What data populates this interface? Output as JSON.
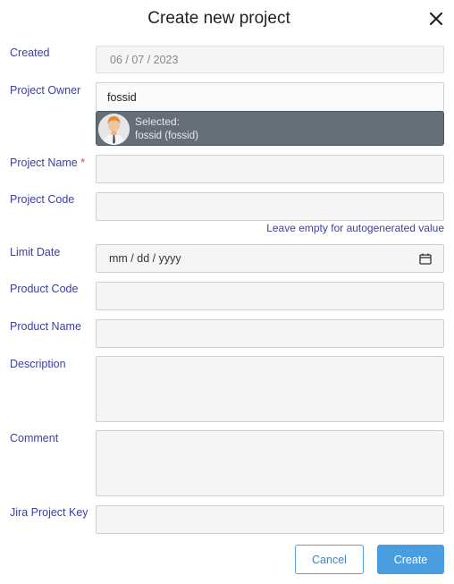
{
  "dialog": {
    "title": "Create new project"
  },
  "fields": {
    "created": {
      "label": "Created",
      "value": "06 / 07 / 2023"
    },
    "owner": {
      "label": "Project Owner",
      "value": "fossid",
      "dropdown_selected": "Selected:",
      "dropdown_user": "fossid (fossid)"
    },
    "project_name": {
      "label": "Project Name",
      "required_mark": "*",
      "value": ""
    },
    "project_code": {
      "label": "Project Code",
      "value": "",
      "hint": "Leave empty for autogenerated value"
    },
    "limit_date": {
      "label": "Limit Date",
      "placeholder": "mm / dd / yyyy"
    },
    "product_code": {
      "label": "Product Code",
      "value": ""
    },
    "product_name": {
      "label": "Product Name",
      "value": ""
    },
    "description": {
      "label": "Description",
      "value": ""
    },
    "comment": {
      "label": "Comment",
      "value": ""
    },
    "jira_key": {
      "label": "Jira Project Key",
      "value": ""
    }
  },
  "buttons": {
    "cancel": "Cancel",
    "create": "Create"
  },
  "icons": {
    "close": "close-icon",
    "calendar": "calendar-icon",
    "avatar": "user-avatar"
  },
  "colors": {
    "label": "#3c3f9f",
    "required": "#e0404a",
    "primary": "#4a9ee0",
    "dropdown_bg": "#656e77"
  }
}
